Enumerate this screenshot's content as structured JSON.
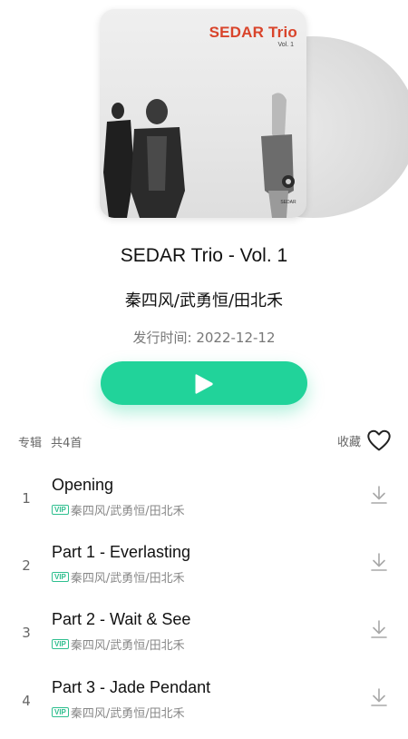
{
  "album": {
    "cover_title": "SEDAR Trio",
    "cover_subtitle": "Vol. 1",
    "cover_logo_text": "SEDAR",
    "title": "SEDAR Trio - Vol. 1",
    "artists": "秦四风/武勇恒/田北禾",
    "release_label": "发行时间:",
    "release_date": "2022-12-12"
  },
  "section": {
    "label": "专辑",
    "count": "共4首",
    "favorite_label": "收藏"
  },
  "vip_badge": "VIP",
  "tracks": [
    {
      "num": "1",
      "title": "Opening",
      "artists": "秦四风/武勇恒/田北禾"
    },
    {
      "num": "2",
      "title": "Part 1 - Everlasting",
      "artists": "秦四风/武勇恒/田北禾"
    },
    {
      "num": "3",
      "title": "Part 2 - Wait & See",
      "artists": "秦四风/武勇恒/田北禾"
    },
    {
      "num": "4",
      "title": "Part 3 - Jade Pendant",
      "artists": "秦四风/武勇恒/田北禾"
    }
  ],
  "colors": {
    "accent": "#21d39a",
    "cover_title": "#d9442b",
    "vip": "#2fbf8f"
  },
  "icons": {
    "play": "play-icon",
    "favorite": "heart-icon",
    "download": "download-icon"
  }
}
